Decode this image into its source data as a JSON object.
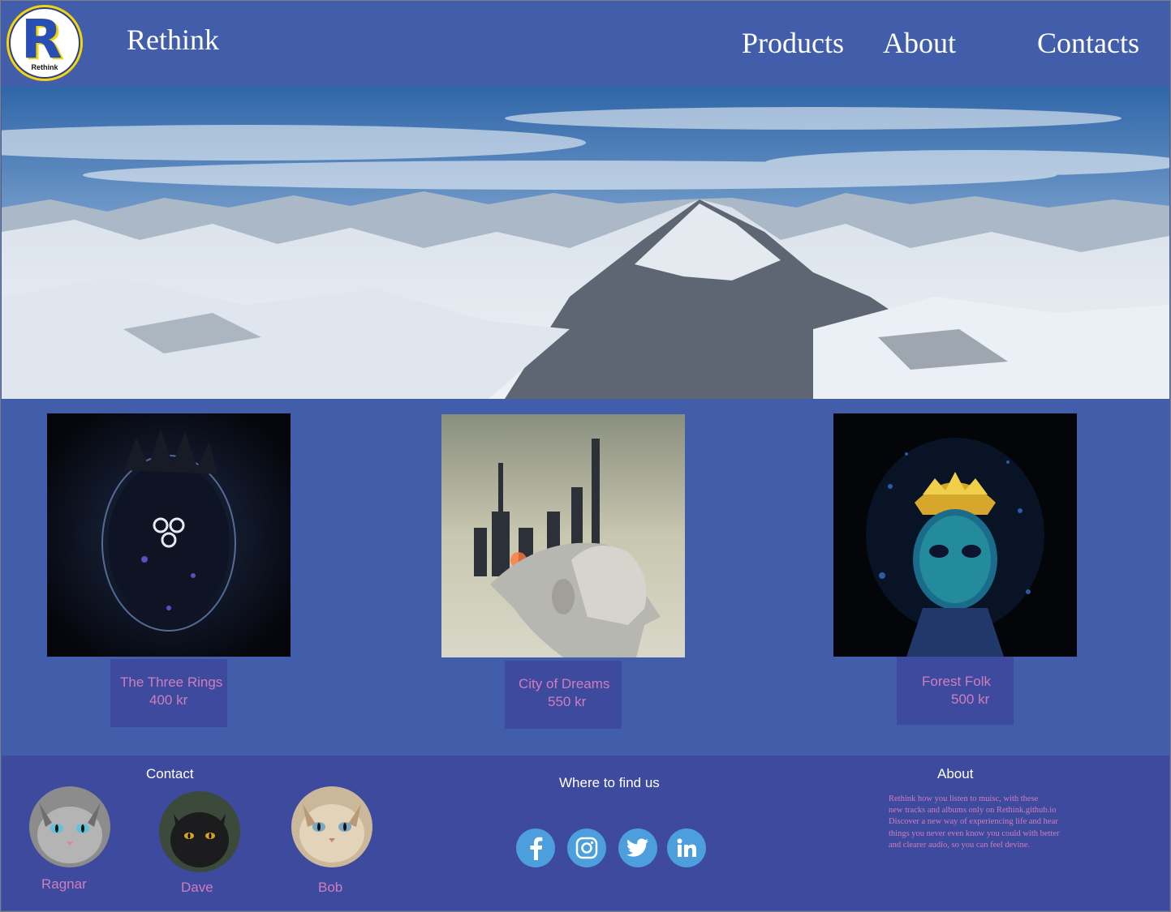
{
  "brand": {
    "logo_text": "Rethink",
    "name": "Rethink"
  },
  "nav": {
    "items": [
      "Products",
      "About",
      "Contacts"
    ]
  },
  "hero": {
    "image": "snowy-mountain-range"
  },
  "products": [
    {
      "name": "The Three Rings",
      "price": "400 kr",
      "cover": "dark-face-with-three-rings"
    },
    {
      "name": "City of Dreams",
      "price": "550 kr",
      "cover": "woman-profile-city-skyline"
    },
    {
      "name": "Forest Folk",
      "price": "500 kr",
      "cover": "glowing-blue-mask-golden-crown"
    }
  ],
  "footer": {
    "contact": {
      "heading": "Contact",
      "members": [
        {
          "name": "Ragnar",
          "photo": "grey-tabby-cat"
        },
        {
          "name": "Dave",
          "photo": "black-cat"
        },
        {
          "name": "Bob",
          "photo": "blue-eyed-tabby-cat"
        }
      ]
    },
    "find_us": {
      "heading": "Where to find us",
      "socials": [
        "facebook-icon",
        "instagram-icon",
        "twitter-icon",
        "linkedin-icon"
      ]
    },
    "about": {
      "heading": "About",
      "text": "Rethink how you listen to muisc, with these\nnew tracks and albums only on Rethink.github.io\nDiscover a new way of experiencing life and hear\nthings you never even know you could with better\nand clearer audio, so you can feel devine."
    }
  },
  "colors": {
    "background": "#425eaa",
    "footer": "#3d4a9e",
    "caption_text": "#cf7ebd",
    "social": "#4c9edc",
    "logo_accent": "#f2d60b"
  }
}
